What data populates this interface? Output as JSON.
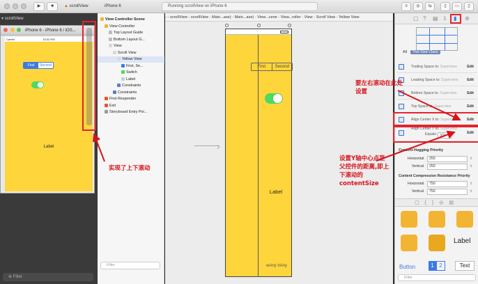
{
  "toolbar": {
    "scheme_left": "scrollView",
    "scheme_device": "iPhone 6",
    "activity_text": "Running scrollView on iPhone 6",
    "stop_label": "■",
    "run_label": "▶"
  },
  "simulator": {
    "title": "iPhone 6 - iPhone 6 / iOS...",
    "time": "10:32 PM",
    "carrier": "Carrier",
    "segments": [
      "First",
      "Second"
    ],
    "label": "Label",
    "sidebar_title": "scrollView"
  },
  "navigator": {
    "filter_placeholder": "Filter",
    "rows": [
      {
        "label": "View Controller Scene",
        "indent": 0,
        "icon": "scene-icon",
        "bold": true
      },
      {
        "label": "View Controller",
        "indent": 1,
        "icon": "view-controller-icon"
      },
      {
        "label": "Top Layout Guide",
        "indent": 2,
        "icon": "layout-guide-icon"
      },
      {
        "label": "Bottom Layout G...",
        "indent": 2,
        "icon": "layout-guide-icon"
      },
      {
        "label": "View",
        "indent": 2,
        "icon": "view-icon"
      },
      {
        "label": "Scroll View",
        "indent": 3,
        "icon": "view-icon"
      },
      {
        "label": "Yellow View",
        "indent": 4,
        "icon": "view-icon"
      },
      {
        "label": "First, Se...",
        "indent": 5,
        "icon": "segmented-icon"
      },
      {
        "label": "Switch",
        "indent": 5,
        "icon": "switch-icon"
      },
      {
        "label": "Label",
        "indent": 5,
        "icon": "label-icon"
      },
      {
        "label": "Constraints",
        "indent": 4,
        "icon": "constraints-icon"
      },
      {
        "label": "Constraints",
        "indent": 3,
        "icon": "constraints-icon"
      },
      {
        "label": "First Responder",
        "indent": 1,
        "icon": "first-responder-icon"
      },
      {
        "label": "Exit",
        "indent": 1,
        "icon": "exit-icon"
      },
      {
        "label": "Storyboard Entry Poi...",
        "indent": 1,
        "icon": "entry-point-icon"
      }
    ]
  },
  "jumpbar": {
    "items": [
      "scrollView",
      "scrollView",
      "Main...ase)",
      "Main...ase)",
      "View...cene",
      "View...roller",
      "View",
      "Scroll View",
      "Yellow View"
    ]
  },
  "storyboard": {
    "segments": [
      "First",
      "Second"
    ],
    "label": "Label",
    "size_class": "wAny hAny"
  },
  "inspector": {
    "tabs": [
      "All",
      "This Size Class"
    ],
    "constraints": [
      {
        "name": "Trailing Space to:",
        "target": "Superview",
        "edit": "Edit"
      },
      {
        "name": "Leading Space to:",
        "target": "Superview",
        "edit": "Edit"
      },
      {
        "name": "Bottom Space to:",
        "target": "Superview",
        "edit": "Edit"
      },
      {
        "name": "Top Space to:",
        "target": "Superview",
        "edit": "Edit"
      },
      {
        "name": "Align Center X to:",
        "target": "Superview",
        "edit": "Edit"
      }
    ],
    "center_y": {
      "name": "Align Center Y to:",
      "target": "Superview",
      "equals_label": "Equals:",
      "value": "300",
      "edit": "Edit"
    },
    "hugging": {
      "title": "Content Hugging Priority",
      "horizontal_label": "Horizontal",
      "horizontal": "250",
      "vertical_label": "Vertical",
      "vertical": "250"
    },
    "compression": {
      "title": "Content Compression Resistance Priority",
      "horizontal_label": "Horizontal",
      "horizontal": "750",
      "vertical_label": "Vertical",
      "vertical": "750"
    },
    "library": {
      "label_item": "Label",
      "button_item": "Button",
      "text_item": "Text",
      "seg1": "1",
      "seg2": "2"
    }
  },
  "annotations": {
    "scroll_note": "实现了上下滚动",
    "horizontal_note": "要左右滚动在此处设置",
    "vertical_note": "设置Y轴中心点至父控件的距离,即上下滚动的contentSize"
  },
  "colors": {
    "yellow": "#FED53A",
    "annotation_red": "#E4242C",
    "switch_green": "#4CD964",
    "segment_blue": "#3B7AE4"
  }
}
